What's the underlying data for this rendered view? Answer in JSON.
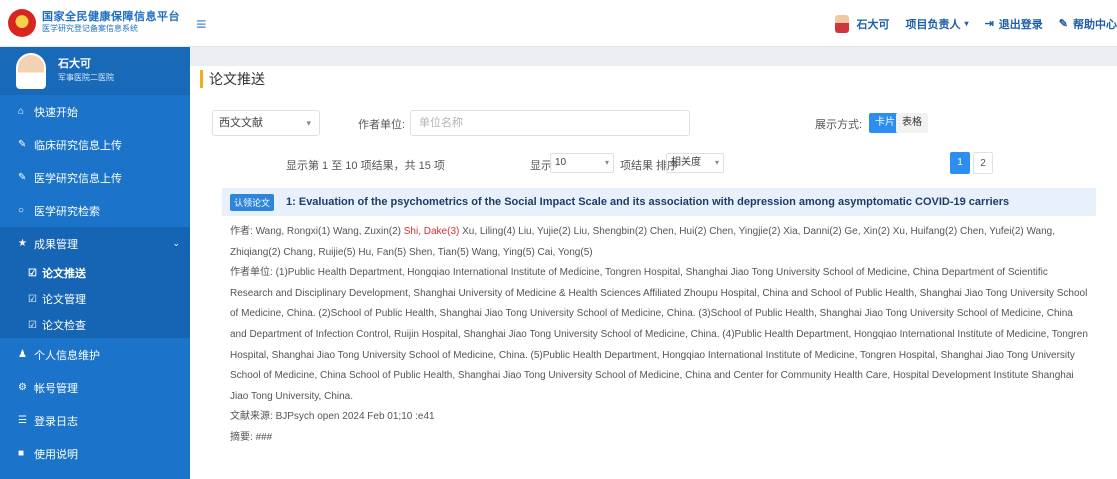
{
  "header": {
    "logo_title": "国家全民健康保障信息平台",
    "logo_subtitle": "医学研究登记备案信息系统",
    "user_name": "石大可",
    "role_label": "项目负责人",
    "logout_label": "退出登录",
    "help_label": "帮助中心"
  },
  "sidebar": {
    "profile_name": "石大可",
    "profile_unit": "军事医院二医院",
    "items": [
      {
        "icon": "home-icon",
        "label": "快速开始"
      },
      {
        "icon": "pencil-icon",
        "label": "临床研究信息上传"
      },
      {
        "icon": "pencil-icon",
        "label": "医学研究信息上传"
      },
      {
        "icon": "circle-icon",
        "label": "医学研究检索"
      },
      {
        "icon": "star-icon",
        "label": "成果管理"
      }
    ],
    "sub_items": [
      {
        "icon": "check-icon",
        "label": "论文推送"
      },
      {
        "icon": "check-icon",
        "label": "论文管理"
      },
      {
        "icon": "check-icon",
        "label": "论文检查"
      }
    ],
    "items_after": [
      {
        "icon": "user-icon",
        "label": "个人信息维护"
      },
      {
        "icon": "gear-icon",
        "label": "帐号管理"
      },
      {
        "icon": "list-icon",
        "label": "登录日志"
      },
      {
        "icon": "book-icon",
        "label": "使用说明"
      }
    ]
  },
  "main": {
    "page_title": "论文推送",
    "filters": {
      "language_select": "西文文献",
      "unit_label": "作者单位:",
      "unit_placeholder": "单位名称",
      "view_label": "展示方式:",
      "view_card": "卡片",
      "view_table": "表格"
    },
    "pager": {
      "range_text": "显示第 1 至 10 项结果，共 15 项",
      "show_label": "显示",
      "per_page_value": "10",
      "per_page_suffix": "项结果 排序",
      "sort_value": "相关度",
      "pages": [
        "1",
        "2"
      ]
    },
    "paper": {
      "tag": "认领论文",
      "title": "1:  Evaluation of the psychometrics of the Social Impact Scale and its association with depression among asymptomatic COVID-19 carriers",
      "authors_label": "作者:",
      "authors_before": "Wang, Rongxi(1)   Wang, Zuxin(2)  ",
      "author_highlight": "Shi, Dake(3)",
      "authors_after": "  Xu, Liling(4)   Liu, Yujie(2)   Liu, Shengbin(2)   Chen, Hui(2)   Chen, Yingjie(2)   Xia, Danni(2)   Ge, Xin(2)   Xu, Huifang(2)   Chen, Yufei(2)   Wang, Zhiqiang(2)   Chang, Ruijie(5)   Hu, Fan(5)   Shen, Tian(5)   Wang, Ying(5)   Cai, Yong(5)",
      "affil_label": "作者单位:",
      "affiliations": "(1)Public Health Department, Hongqiao International Institute of Medicine, Tongren Hospital, Shanghai Jiao Tong University School of Medicine, China  Department of Scientific Research and Disciplinary Development, Shanghai University of Medicine & Health Sciences Affiliated Zhoupu Hospital, China  and School of Public Health, Shanghai Jiao Tong University School of Medicine, China.  (2)School of Public Health, Shanghai Jiao Tong University School of Medicine, China.  (3)School of Public Health, Shanghai Jiao Tong University School of Medicine, China  and Department of Infection Control, Ruijin Hospital, Shanghai Jiao Tong University School of Medicine, China.  (4)Public Health Department, Hongqiao International Institute of Medicine, Tongren Hospital, Shanghai Jiao Tong University School of Medicine, China.  (5)Public Health Department, Hongqiao International Institute of Medicine, Tongren Hospital, Shanghai Jiao Tong University School of Medicine, China  School of Public Health, Shanghai Jiao Tong University School of Medicine, China  and Center for Community Health Care, Hospital Development Institute Shanghai Jiao Tong University, China.",
      "source_label": "文献来源:",
      "source_value": "BJPsych open   2024 Feb 01;10 :e41",
      "next_label": "摘要:",
      "next_value": "###"
    }
  }
}
